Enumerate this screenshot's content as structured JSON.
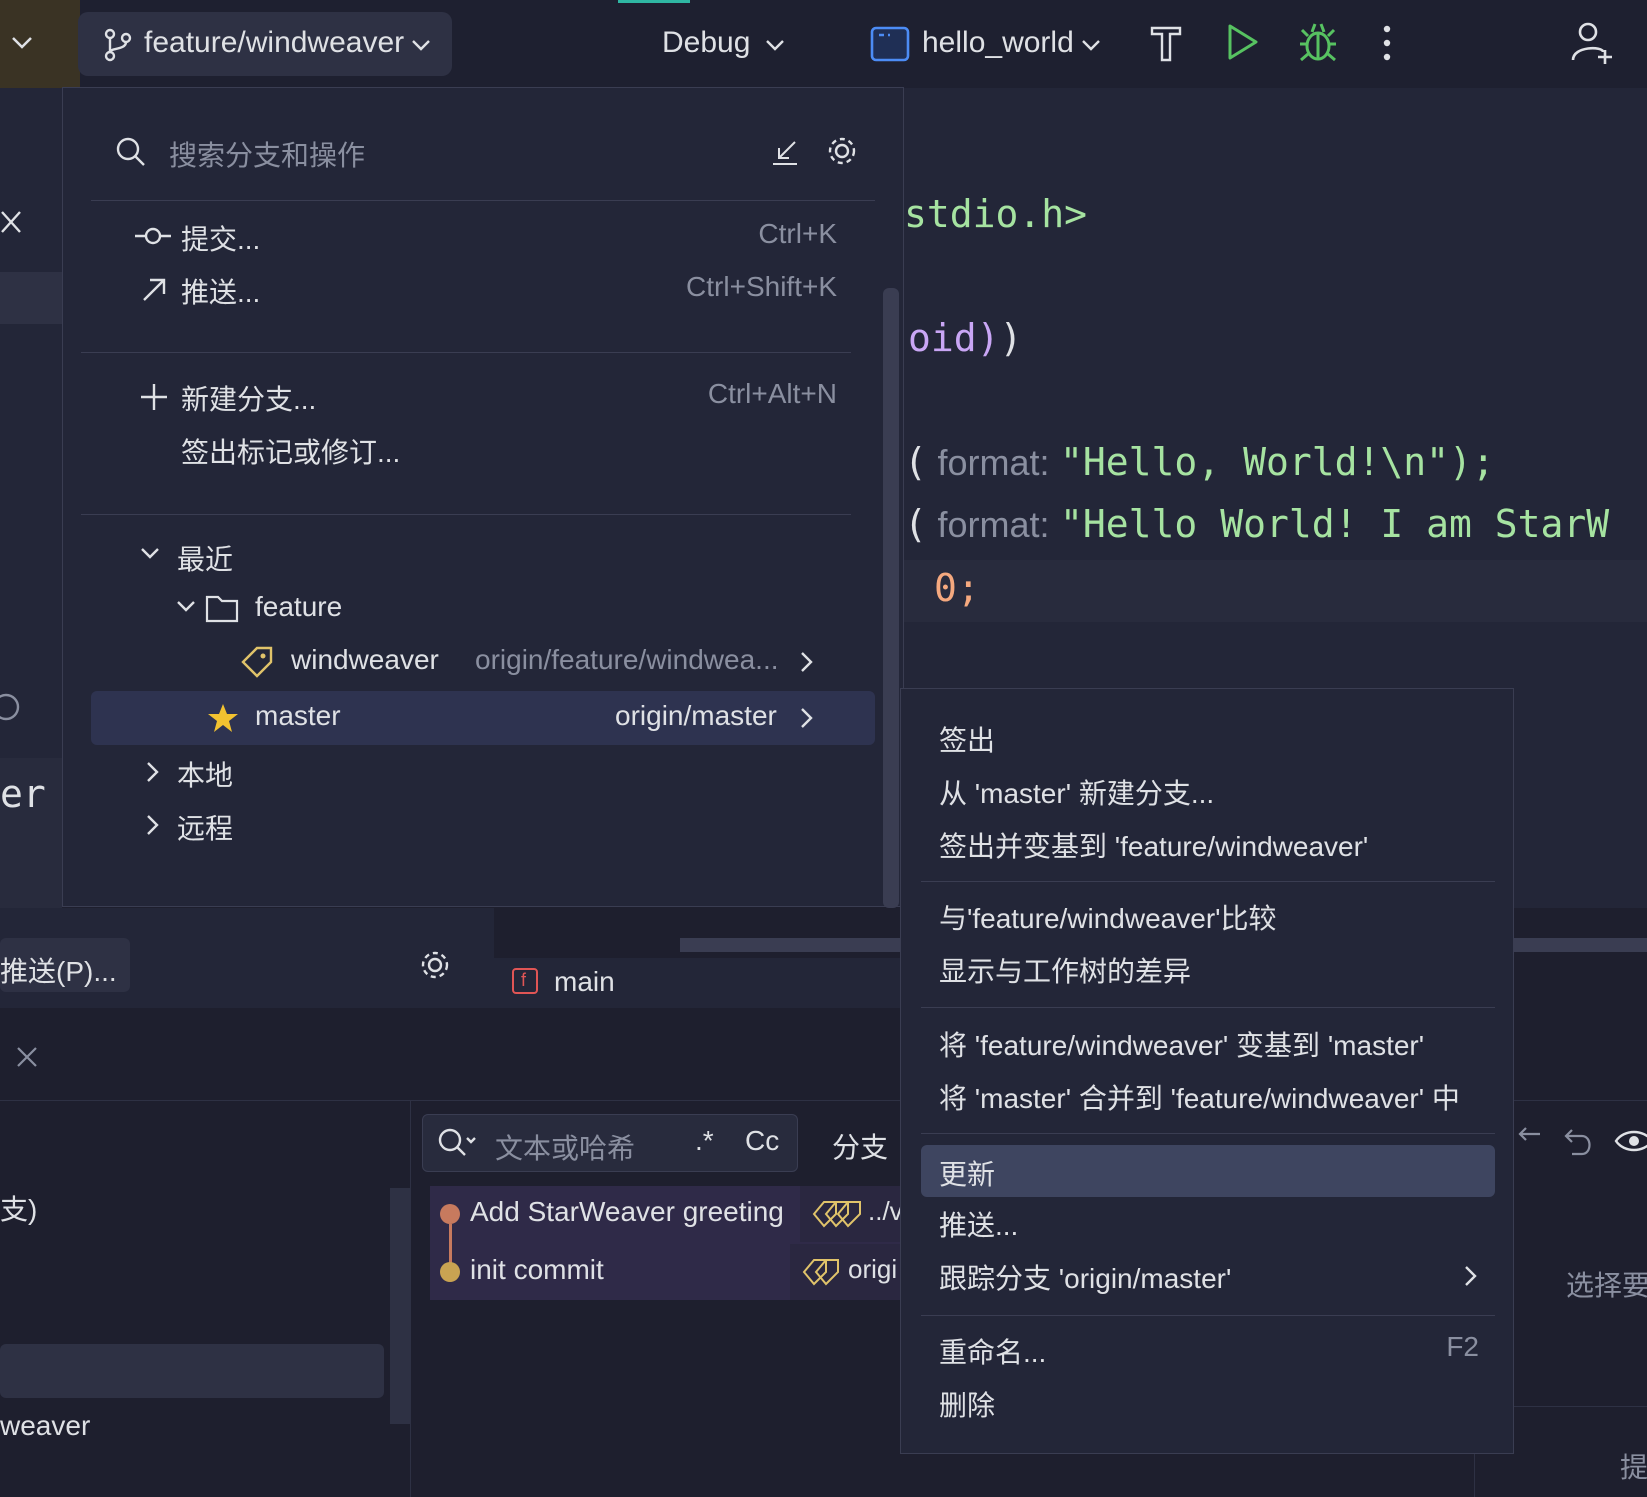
{
  "toolbar": {
    "branch": "feature/windweaver",
    "config": "Debug",
    "run_target": "hello_world"
  },
  "branch_popup": {
    "search_placeholder": "搜索分支和操作",
    "actions": [
      {
        "label": "提交...",
        "shortcut": "Ctrl+K",
        "icon": "commit-icon"
      },
      {
        "label": "推送...",
        "shortcut": "Ctrl+Shift+K",
        "icon": "push-arrow-icon"
      },
      {
        "label": "新建分支...",
        "shortcut": "Ctrl+Alt+N",
        "icon": "plus-icon"
      },
      {
        "label": "签出标记或修订...",
        "shortcut": ""
      }
    ],
    "groups": {
      "recent": "最近",
      "folder": "feature",
      "local": "本地",
      "remote": "远程"
    },
    "branches": [
      {
        "name": "windweaver",
        "tracking": "origin/feature/windwea...",
        "icon": "tag-icon"
      },
      {
        "name": "master",
        "tracking": "origin/master",
        "icon": "star-icon"
      }
    ]
  },
  "context_menu": {
    "items": [
      {
        "label": "签出"
      },
      {
        "label": "从 'master' 新建分支..."
      },
      {
        "label": "签出并变基到 'feature/windweaver'"
      },
      {
        "label": "与'feature/windweaver'比较"
      },
      {
        "label": "显示与工作树的差异"
      },
      {
        "label": "将 'feature/windweaver' 变基到 'master'"
      },
      {
        "label": "将 'master' 合并到 'feature/windweaver' 中"
      },
      {
        "label": "更新"
      },
      {
        "label": "推送..."
      },
      {
        "label": "跟踪分支 'origin/master'"
      },
      {
        "label": "重命名...",
        "shortcut": "F2"
      },
      {
        "label": "删除"
      }
    ]
  },
  "editor": {
    "line1": "stdio.h>",
    "line2": "oid)",
    "line3_param": "format:",
    "line3_str": "\"Hello, World!\\n\");",
    "line4_param": "format:",
    "line4_str": "\"Hello World! I am StarW",
    "line5": "0;",
    "breadcrumb_fn": "main"
  },
  "left_panel": {
    "push_button": "推送(P)...",
    "frag_er": "er",
    "frag_branch": "支)",
    "frag_weaver": "weaver"
  },
  "git_log": {
    "filter_placeholder": "文本或哈希",
    "regex_label": ".*",
    "case_label": "Cc",
    "branch_filter": "分支",
    "commits": [
      {
        "message": "Add StarWeaver greeting",
        "refs": "../v"
      },
      {
        "message": "init commit",
        "refs": "origi"
      }
    ]
  },
  "right_panel": {
    "select_hint": "选择要",
    "bottom_hint": "提"
  },
  "colors": {
    "accent": "#3e4560",
    "string_green": "#a6e3a1",
    "keyword_purple": "#c9a6f5",
    "number_orange": "#f5a97f"
  }
}
